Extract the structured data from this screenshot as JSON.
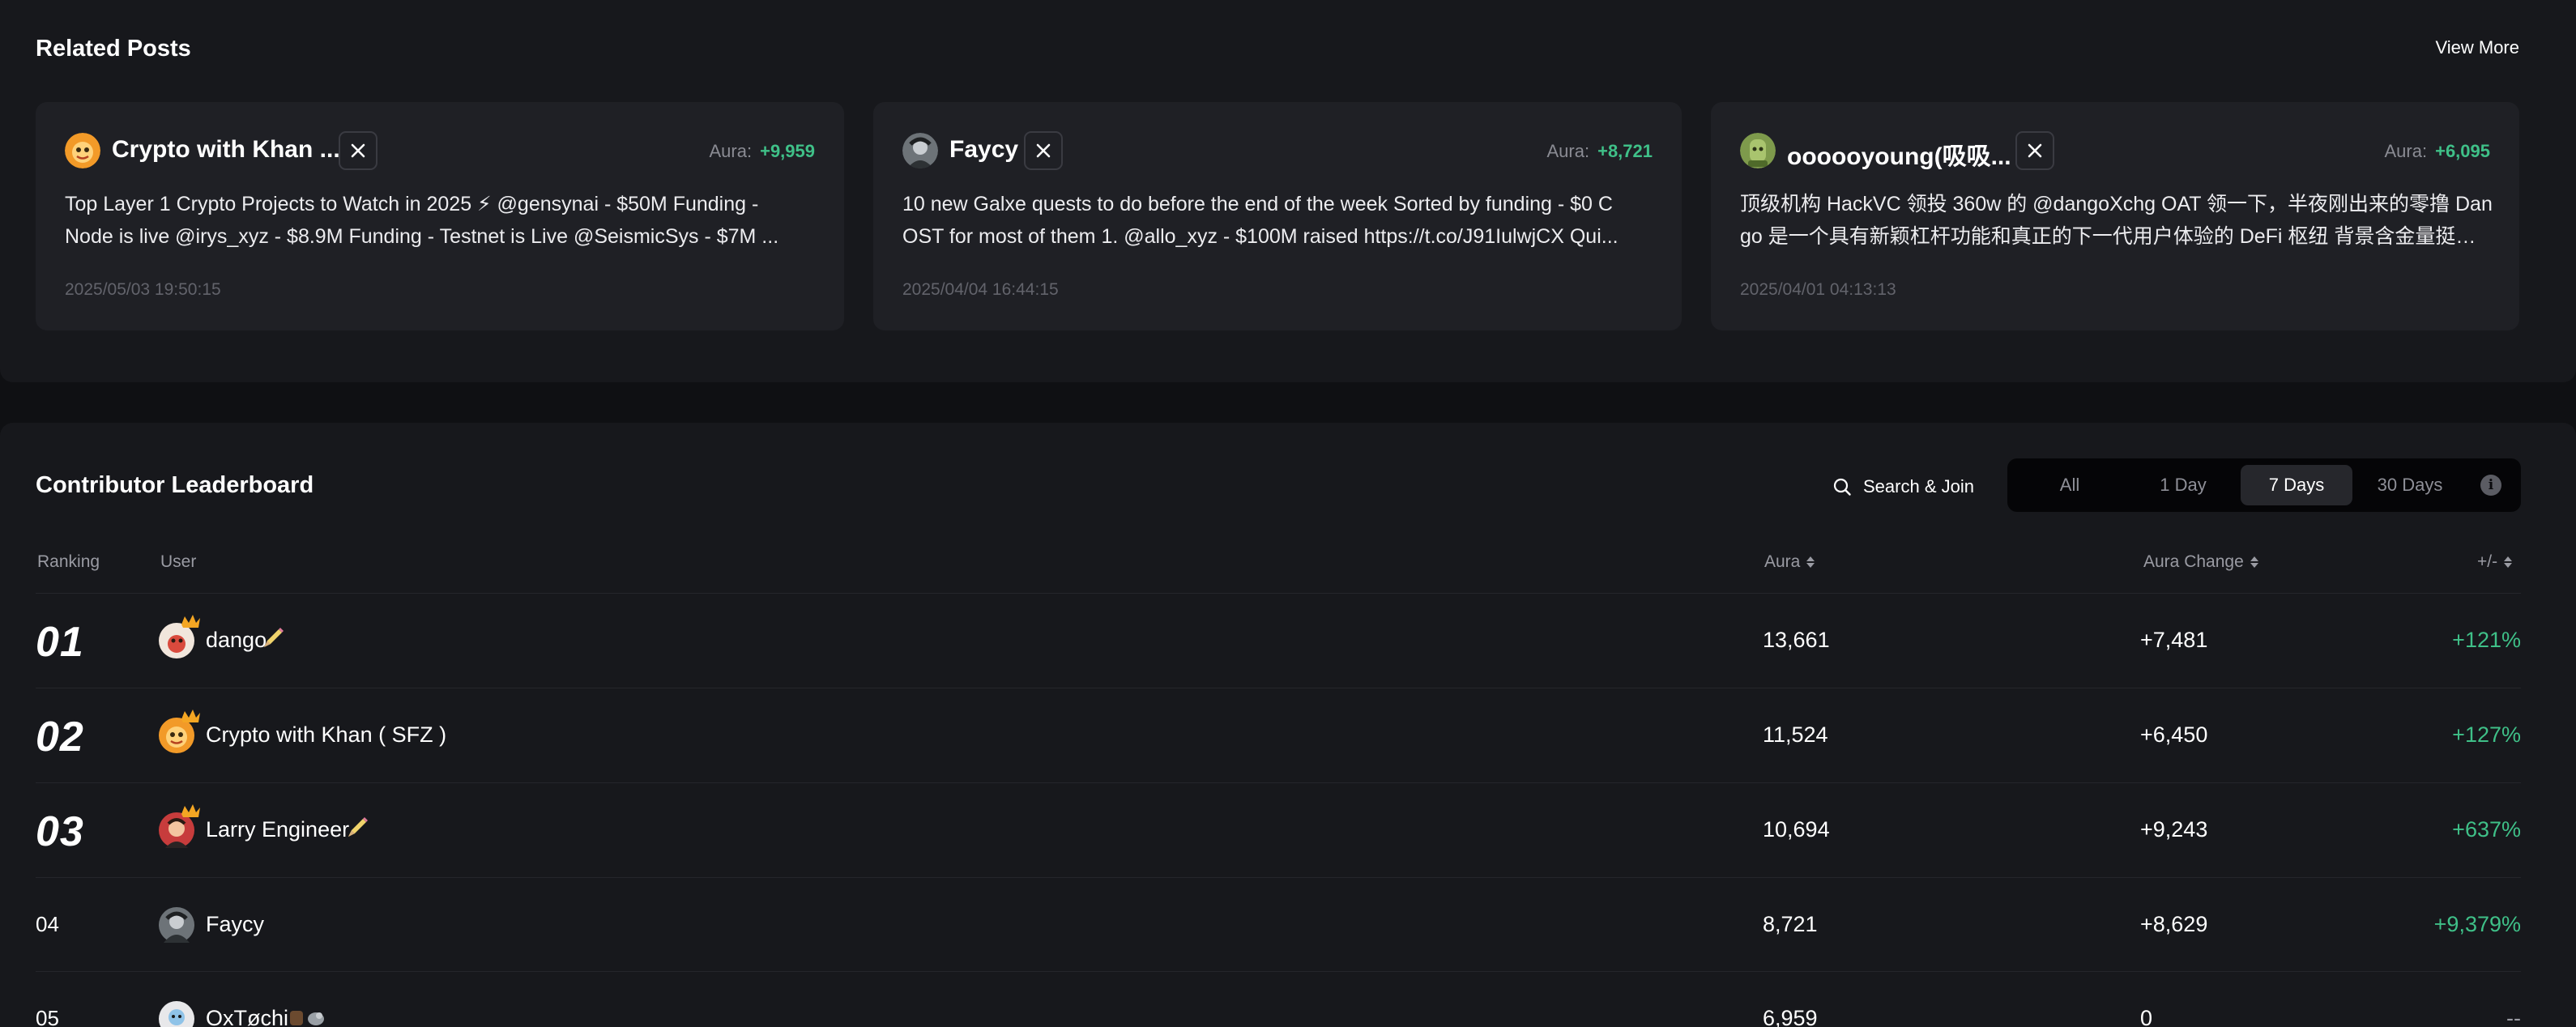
{
  "related": {
    "title": "Related Posts",
    "view_more": "View More",
    "aura_label": "Aura:",
    "cards": [
      {
        "name": "Crypto with Khan ...",
        "aura": "+9,959",
        "line1": "Top Layer 1 Crypto Projects to Watch in 2025 ⚡ @gensynai - $50M Funding -",
        "line2": "Node is live @irys_xyz - $8.9M Funding - Testnet is Live @SeismicSys - $7M ...",
        "date": "2025/05/03 19:50:15"
      },
      {
        "name": "Faycy",
        "aura": "+8,721",
        "line1": "10 new Galxe quests to do before the end of the week Sorted by funding - $0 C",
        "line2": "OST for most of them 1. @allo_xyz - $100M raised https://t.co/J91IulwjCX Qui...",
        "date": "2025/04/04 16:44:15"
      },
      {
        "name": "oooooyoung(吸吸...",
        "aura": "+6,095",
        "line1": "顶级机构 HackVC 领投 360w 的 @dangoXchg OAT 领一下，半夜刚出来的零撸 Dan",
        "line2": "go 是一个具有新颖杠杆功能和真正的下一代用户体验的 DeFi 枢纽 背景含金量挺高的...",
        "date": "2025/04/01 04:13:13"
      }
    ]
  },
  "leaderboard": {
    "title": "Contributor Leaderboard",
    "search_join": "Search & Join",
    "periods": [
      "All",
      "1 Day",
      "7 Days",
      "30 Days"
    ],
    "active_period": "7 Days",
    "columns": {
      "ranking": "Ranking",
      "user": "User",
      "aura": "Aura",
      "aura_change": "Aura Change",
      "pct": "+/-"
    },
    "rows": [
      {
        "rank": "01",
        "name": "dango",
        "aura": "13,661",
        "change": "+7,481",
        "pct": "+121%"
      },
      {
        "rank": "02",
        "name": "Crypto with Khan ( SFZ )",
        "aura": "11,524",
        "change": "+6,450",
        "pct": "+127%"
      },
      {
        "rank": "03",
        "name": "Larry Engineer",
        "aura": "10,694",
        "change": "+9,243",
        "pct": "+637%"
      },
      {
        "rank": "04",
        "name": "Faycy",
        "aura": "8,721",
        "change": "+8,629",
        "pct": "+9,379%"
      },
      {
        "rank": "05",
        "name": "OxTøchi",
        "aura": "6,959",
        "change": "0",
        "pct": "--"
      }
    ]
  },
  "colors": {
    "positive": "#3fc088",
    "background": "#0f1013",
    "panel": "#17181c",
    "card": "#1f2025"
  },
  "icons": [
    "x-logo-icon",
    "search-icon",
    "info-icon",
    "sort-icon",
    "crown-icon",
    "pencil-icon",
    "avatar-icon"
  ]
}
